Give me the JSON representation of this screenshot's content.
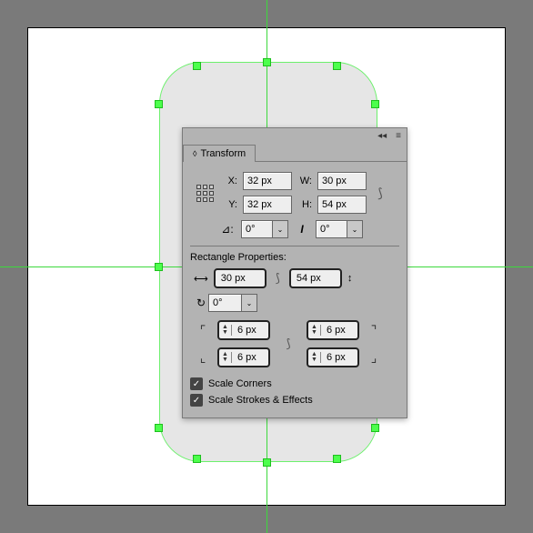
{
  "panel": {
    "title": "Transform",
    "x_label": "X:",
    "y_label": "Y:",
    "w_label": "W:",
    "h_label": "H:",
    "x_value": "32 px",
    "y_value": "32 px",
    "w_value": "30 px",
    "h_value": "54 px",
    "rotate_value": "0°",
    "shear_value": "0°"
  },
  "rect": {
    "title": "Rectangle Properties:",
    "width": "30 px",
    "height": "54 px",
    "rotation": "0°",
    "corners": {
      "tl": "6 px",
      "tr": "6 px",
      "bl": "6 px",
      "br": "6 px"
    }
  },
  "options": {
    "scale_corners": "Scale Corners",
    "scale_strokes": "Scale Strokes & Effects"
  },
  "icons": {
    "collapse": "◂◂",
    "menu": "≡",
    "link": "⟆",
    "angle": "⊿:",
    "shear": "I",
    "dd": "⌄",
    "width": "⟷",
    "height": "↕",
    "rotate": "↻",
    "tl": "⌜",
    "tr": "⌝",
    "bl": "⌞",
    "br": "⌟",
    "up": "▲",
    "down": "▼",
    "check": "✓"
  }
}
